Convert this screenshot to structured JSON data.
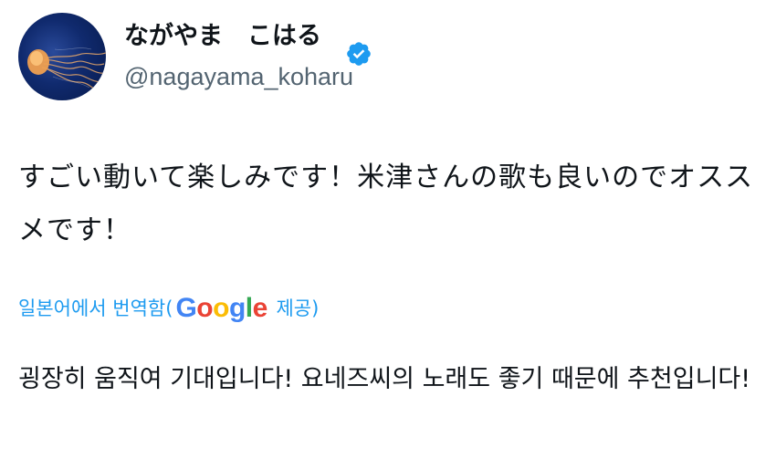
{
  "profile": {
    "display_name": "ながやま　こはる",
    "handle": "@nagayama_koharu",
    "verified": true,
    "avatar_icon": "jellyfish-avatar"
  },
  "tweet": {
    "text": "すごい動いて楽しみです！米津さんの歌も良いのでオススメです！"
  },
  "translation": {
    "prefix": "일본어에서 번역함(",
    "provider_logo": "Google",
    "suffix": " 제공)",
    "text": "굉장히 움직여 기대입니다! 요네즈씨의 노래도 좋기 때문에 추천입니다!"
  },
  "colors": {
    "link": "#1d9bf0",
    "handle": "#536471",
    "text": "#0f1419",
    "verified_badge": "#1d9bf0"
  }
}
